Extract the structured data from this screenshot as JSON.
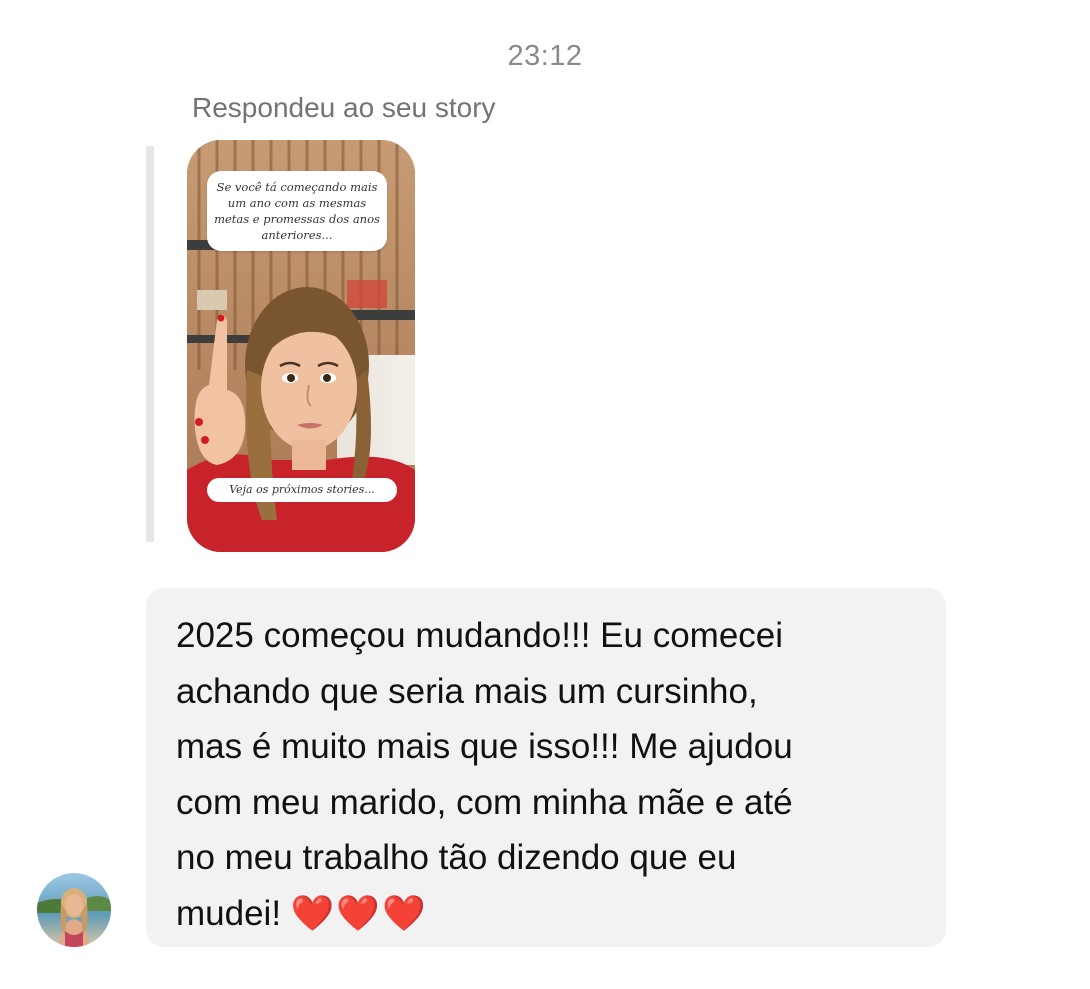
{
  "conversation": {
    "timestamp": "23:12",
    "reply_context": "Respondeu ao seu story",
    "story": {
      "caption": "Se você tá começando mais um ano com as mesmas metas e promessas dos anos anteriores...",
      "footer": "Veja os próximos stories..."
    },
    "message": {
      "lines": [
        "2025 começou mudando!!! Eu comecei",
        "achando que seria mais um cursinho,",
        "mas é muito mais que isso!!! Me ajudou",
        "com meu marido, com minha mãe e até",
        "no meu trabalho tão dizendo que eu",
        "mudei!"
      ],
      "emoji": "❤️❤️❤️"
    },
    "sender_avatar": "sender-avatar-photo"
  },
  "colors": {
    "bubble_bg": "#f2f2f2",
    "meta_text": "#8a8a8a",
    "reply_bar": "#e6e6e6",
    "heart": "#e0141b"
  }
}
